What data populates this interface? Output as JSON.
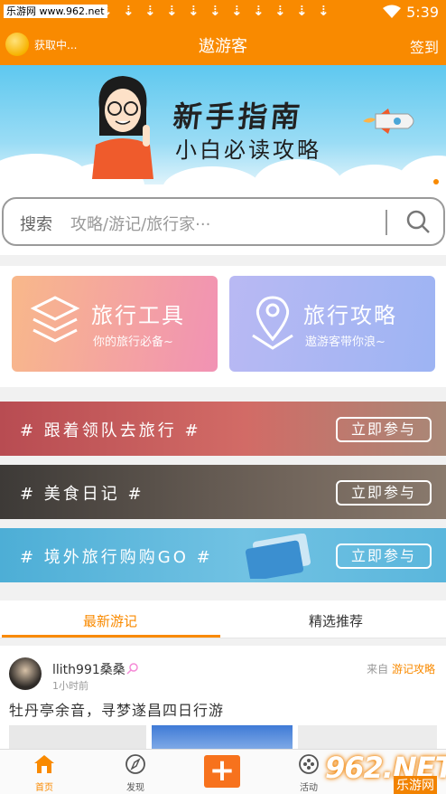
{
  "status": {
    "watermark": "乐游网 www.962.net",
    "download_glyph": "⇣",
    "time": "5:39"
  },
  "header": {
    "loading": "获取中...",
    "title": "遨游客",
    "sign_in": "签到"
  },
  "banner": {
    "headline": "新手指南",
    "subline": "小白必读攻略"
  },
  "search": {
    "label": "搜索",
    "placeholder": "攻略/游记/旅行家···"
  },
  "cards": [
    {
      "title": "旅行工具",
      "subtitle": "你的旅行必备~"
    },
    {
      "title": "旅行攻略",
      "subtitle": "遨游客带你浪~"
    }
  ],
  "activities": [
    {
      "title": "# 跟着领队去旅行 #",
      "button": "立即参与"
    },
    {
      "title": "# 美食日记 #",
      "button": "立即参与"
    },
    {
      "title": "# 境外旅行购购GO #",
      "button": "立即参与"
    }
  ],
  "tabs": {
    "latest": "最新游记",
    "featured": "精选推荐"
  },
  "post": {
    "user": "llith991桑桑",
    "time": "1小时前",
    "from_prefix": "来自",
    "from_link": "游记攻略",
    "title": "牡丹亭余音，寻梦遂昌四日行游"
  },
  "nav": {
    "home": "首页",
    "discover": "发现",
    "add": "+",
    "activity": "活动"
  },
  "overlay": {
    "logo": "962.NET",
    "site": "乐游网"
  },
  "colors": {
    "accent": "#f98a00"
  }
}
